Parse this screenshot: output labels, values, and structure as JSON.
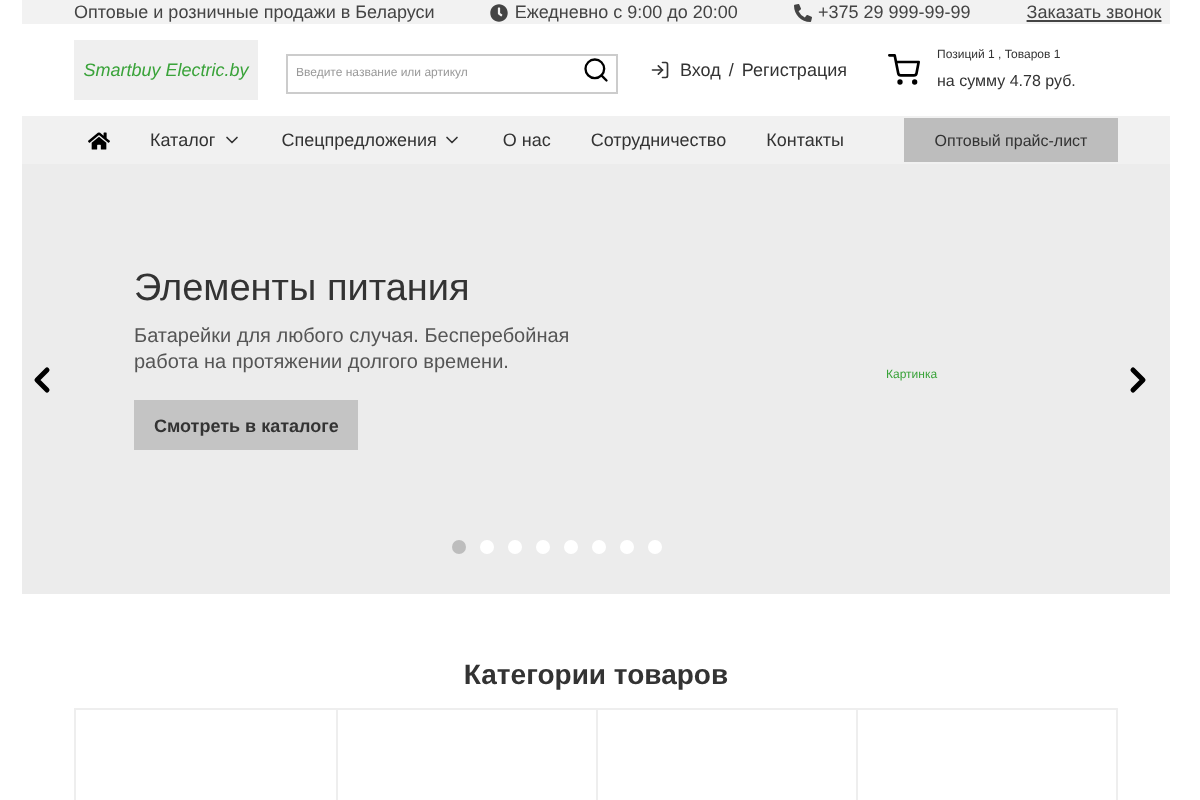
{
  "top_bar": {
    "tagline": "Оптовые и розничные продажи в Беларуси",
    "hours": "Ежедневно с 9:00 до 20:00",
    "phone": "+375 29 999-99-99",
    "callback_link": "Заказать звонок"
  },
  "header": {
    "logo": "Smartbuy Electric.by",
    "search": {
      "placeholder": "Введите название или артикул"
    },
    "login": "Вход",
    "separator": "/",
    "register": "Регистрация",
    "cart": {
      "summary": "Позиций 1 , Товаров 1",
      "total": "на сумму 4.78 руб."
    }
  },
  "nav": {
    "items": [
      {
        "label": "Каталог",
        "dropdown": true
      },
      {
        "label": "Спецпредложения",
        "dropdown": true
      },
      {
        "label": "О нас",
        "dropdown": false
      },
      {
        "label": "Сотрудничество",
        "dropdown": false
      },
      {
        "label": "Контакты",
        "dropdown": false
      }
    ],
    "price_list_button": "Оптовый прайс-лист"
  },
  "slider": {
    "title": "Элементы питания",
    "text": "Батарейки для любого случая. Бесперебойная работа на протяжении долгого времени.",
    "button": "Смотреть в каталоге",
    "image_caption": "Картинка",
    "dots": [
      {
        "selected": true
      },
      {
        "selected": false
      },
      {
        "selected": false
      },
      {
        "selected": false
      },
      {
        "selected": false
      },
      {
        "selected": false
      },
      {
        "selected": false
      },
      {
        "selected": false
      }
    ]
  },
  "categories": {
    "title": "Категории товаров"
  }
}
